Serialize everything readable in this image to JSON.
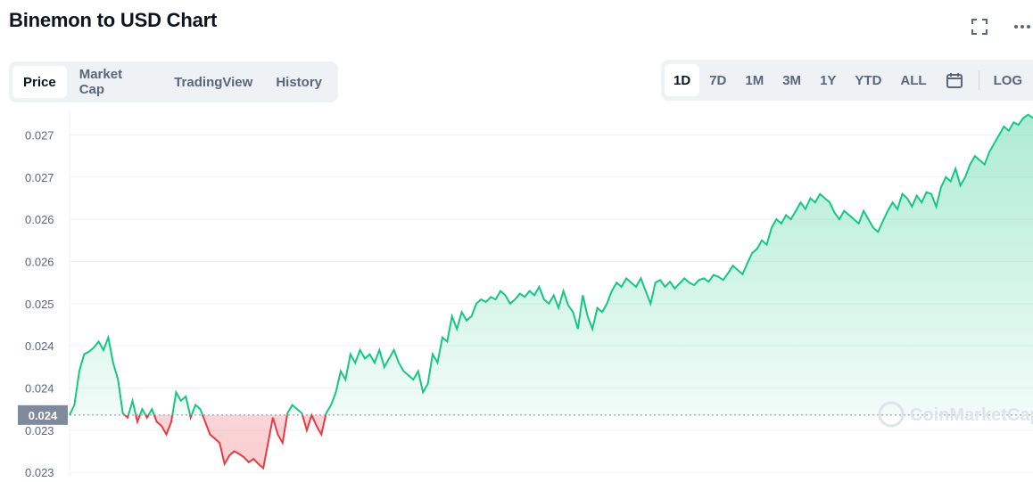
{
  "header": {
    "title": "Binemon to USD Chart",
    "fullscreen_icon": "fullscreen-icon",
    "more_icon": "more-icon"
  },
  "tabs": [
    {
      "label": "Price",
      "active": true
    },
    {
      "label": "Market Cap",
      "active": false
    },
    {
      "label": "TradingView",
      "active": false
    },
    {
      "label": "History",
      "active": false
    }
  ],
  "ranges": [
    {
      "label": "1D",
      "active": true
    },
    {
      "label": "7D",
      "active": false
    },
    {
      "label": "1M",
      "active": false
    },
    {
      "label": "3M",
      "active": false
    },
    {
      "label": "1Y",
      "active": false
    },
    {
      "label": "YTD",
      "active": false
    },
    {
      "label": "ALL",
      "active": false
    }
  ],
  "calendar_icon": "calendar-icon",
  "log_label": "LOG",
  "watermark": "CoinMarketCap",
  "colors": {
    "up": "#16c784",
    "down": "#ea3943",
    "current_badge_bg": "#808a9d",
    "grid": "#eff2f5",
    "axis_text": "#58667e"
  },
  "chart_data": {
    "type": "line",
    "title": "Binemon to USD Chart",
    "xlabel": "",
    "ylabel": "",
    "ylim": [
      0.02296,
      0.02729
    ],
    "y_ticks": [
      {
        "value": 0.023,
        "label": "0.023"
      },
      {
        "value": 0.0235,
        "label": "0.023"
      },
      {
        "value": 0.024,
        "label": "0.024"
      },
      {
        "value": 0.0245,
        "label": "0.024"
      },
      {
        "value": 0.025,
        "label": "0.025"
      },
      {
        "value": 0.0255,
        "label": "0.026"
      },
      {
        "value": 0.026,
        "label": "0.026"
      },
      {
        "value": 0.0265,
        "label": "0.027"
      },
      {
        "value": 0.027,
        "label": "0.027"
      }
    ],
    "reference_value": 0.02368,
    "reference_label": "0.024",
    "grid": true,
    "values": [
      0.02368,
      0.0238,
      0.0242,
      0.0244,
      0.02443,
      0.02448,
      0.02455,
      0.02445,
      0.0246,
      0.0243,
      0.0241,
      0.0237,
      0.02365,
      0.02385,
      0.0236,
      0.02375,
      0.02365,
      0.02375,
      0.0236,
      0.02355,
      0.02345,
      0.0236,
      0.02395,
      0.02385,
      0.0239,
      0.02365,
      0.0238,
      0.02375,
      0.0236,
      0.02345,
      0.0234,
      0.02335,
      0.0231,
      0.0232,
      0.02325,
      0.02322,
      0.02318,
      0.02312,
      0.02316,
      0.0231,
      0.02305,
      0.02335,
      0.02365,
      0.02345,
      0.02335,
      0.0237,
      0.0238,
      0.02375,
      0.0237,
      0.0235,
      0.02368,
      0.02355,
      0.02345,
      0.0237,
      0.0238,
      0.02395,
      0.0242,
      0.0241,
      0.0244,
      0.0243,
      0.02445,
      0.02435,
      0.0244,
      0.0243,
      0.02445,
      0.02425,
      0.02435,
      0.02445,
      0.0243,
      0.0242,
      0.02415,
      0.0241,
      0.0242,
      0.02395,
      0.02405,
      0.0244,
      0.0243,
      0.0246,
      0.02455,
      0.02485,
      0.0247,
      0.0249,
      0.0248,
      0.02485,
      0.025,
      0.02505,
      0.02502,
      0.02508,
      0.02505,
      0.02515,
      0.0251,
      0.025,
      0.02505,
      0.02512,
      0.02508,
      0.02515,
      0.0251,
      0.0252,
      0.02505,
      0.025,
      0.0251,
      0.02495,
      0.02515,
      0.02498,
      0.0249,
      0.0247,
      0.0251,
      0.02485,
      0.0247,
      0.02495,
      0.0249,
      0.025,
      0.02515,
      0.02525,
      0.0252,
      0.0253,
      0.02525,
      0.0252,
      0.0253,
      0.02515,
      0.025,
      0.02525,
      0.02528,
      0.0252,
      0.02526,
      0.02518,
      0.02524,
      0.0253,
      0.02525,
      0.02522,
      0.02528,
      0.0253,
      0.02526,
      0.02534,
      0.02532,
      0.02528,
      0.02536,
      0.02545,
      0.0254,
      0.02535,
      0.02548,
      0.0256,
      0.02565,
      0.02575,
      0.0257,
      0.0259,
      0.026,
      0.02595,
      0.02605,
      0.026,
      0.0261,
      0.0262,
      0.02612,
      0.02625,
      0.0262,
      0.0263,
      0.02625,
      0.0262,
      0.02608,
      0.026,
      0.0261,
      0.02605,
      0.026,
      0.02595,
      0.0261,
      0.026,
      0.0259,
      0.02585,
      0.02598,
      0.0261,
      0.0262,
      0.02612,
      0.0263,
      0.02625,
      0.02615,
      0.02628,
      0.0262,
      0.02632,
      0.0263,
      0.02615,
      0.02638,
      0.0265,
      0.02645,
      0.0266,
      0.0264,
      0.0265,
      0.02665,
      0.02675,
      0.0267,
      0.02665,
      0.0268,
      0.0269,
      0.027,
      0.0271,
      0.02705,
      0.02715,
      0.02712,
      0.0272,
      0.02724,
      0.0272
    ],
    "baseline_split_color_above": "up",
    "baseline_split_color_below": "down"
  }
}
